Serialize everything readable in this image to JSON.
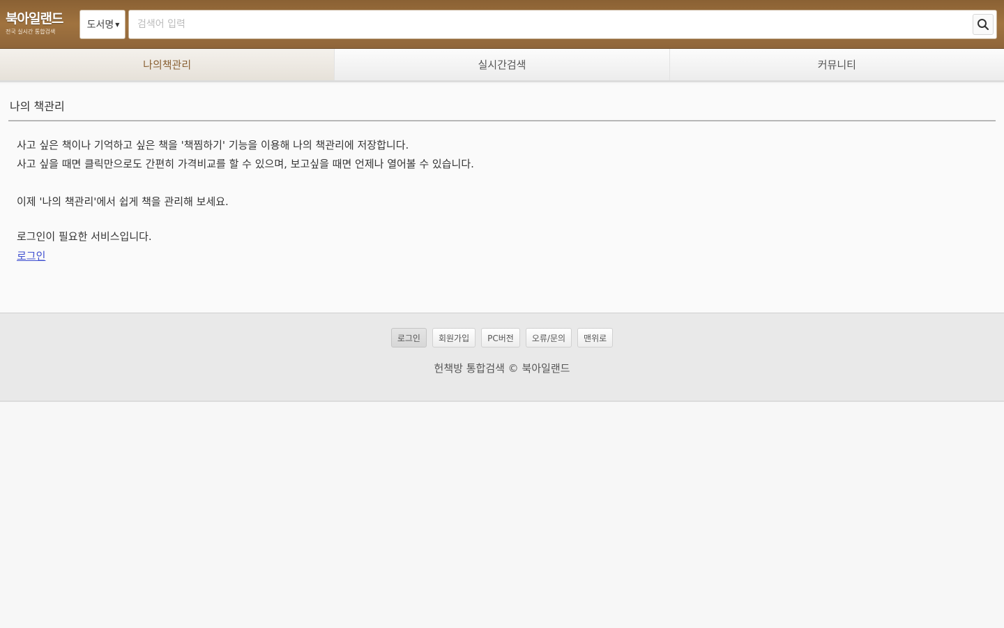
{
  "header": {
    "logo_main": "북아일랜드",
    "logo_sub": "전국 실시간 통합검색",
    "category_selected": "도서명",
    "search_placeholder": "검색어 입력",
    "colors": {
      "header_brown": "#9a6e3e",
      "tab_active_text": "#8a6134",
      "link": "#3f4fd0"
    }
  },
  "tabs": [
    {
      "label": "나의책관리",
      "active": true
    },
    {
      "label": "실시간검색",
      "active": false
    },
    {
      "label": "커뮤니티",
      "active": false
    }
  ],
  "main": {
    "section_title": "나의 책관리",
    "desc_line1": "사고 싶은 책이나 기억하고 싶은 책을 '책찜하기' 기능을 이용해 나의 책관리에 저장합니다.",
    "desc_line2": "사고 싶을 때면 클릭만으로도 간편히 가격비교를 할 수 있으며, 보고싶을 때면 언제나 열어볼 수 있습니다.",
    "desc_line3": "이제 '나의 책관리'에서 쉽게 책을 관리해 보세요.",
    "login_notice": "로그인이 필요한 서비스입니다.",
    "login_link": "로그인"
  },
  "footer": {
    "buttons": [
      "로그인",
      "회원가입",
      "PC버전",
      "오류/문의",
      "맨위로"
    ],
    "copyright": "헌책방 통합검색 © 북아일랜드"
  }
}
